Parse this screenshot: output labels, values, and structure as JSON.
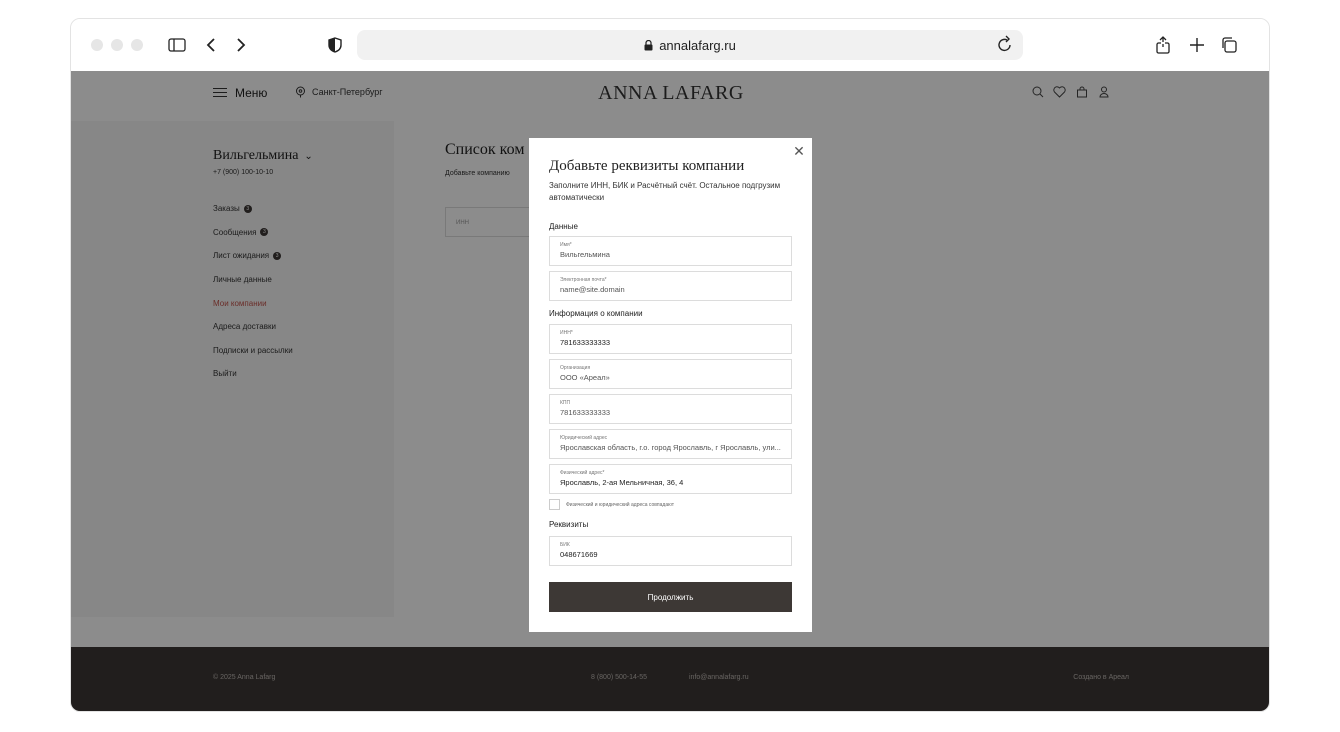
{
  "browser": {
    "url": "annalafarg.ru"
  },
  "header": {
    "menu_label": "Меню",
    "city": "Санкт-Петербург",
    "logo": "ANNA LAFARG"
  },
  "sidebar": {
    "user_name": "Вильгельмина",
    "phone": "+7 (900) 100-10-10",
    "items": [
      {
        "label": "Заказы",
        "badge": "3"
      },
      {
        "label": "Сообщения",
        "badge": "3"
      },
      {
        "label": "Лист ожидания",
        "badge": "3"
      },
      {
        "label": "Личные данные"
      },
      {
        "label": "Мои компании"
      },
      {
        "label": "Адреса доставки"
      },
      {
        "label": "Подписки и рассылки"
      },
      {
        "label": "Выйти"
      }
    ]
  },
  "content": {
    "title": "Список ком",
    "subtitle": "Добавьте компанию",
    "inn_placeholder": "ИНН"
  },
  "modal": {
    "title": "Добавьте реквизиты компании",
    "subtitle": "Заполните ИНН, БИК и Расчётный счёт. Остальное подгрузим автоматически",
    "section_data": "Данные",
    "name_label": "Имя*",
    "name_value": "Вильгельмина",
    "email_label": "Электронная почта*",
    "email_value": "name@site.domain",
    "section_company": "Информация о компании",
    "inn_label": "ИНН*",
    "inn_value": "781633333333",
    "org_label": "Организация",
    "org_value": "ООО «Ареал»",
    "kpp_label": "КПП",
    "kpp_value": "781633333333",
    "legal_label": "Юридический адрес",
    "legal_value": "Ярославская область, г.о. город Ярославль, г Ярославль, ули...",
    "phys_label": "Физический адрес*",
    "phys_value": "Ярославль, 2-ая Мельничная, 36, 4",
    "checkbox_label": "Физический и юридический адреса совпадают",
    "section_requisites": "Реквизиты",
    "bik_label": "БИК",
    "bik_value": "048671669",
    "submit": "Продолжить"
  },
  "footer": {
    "copyright": "© 2025 Anna Lafarg",
    "phone": "8 (800) 500-14-55",
    "email": "info@annalafarg.ru",
    "made_by": "Создано в Ареал"
  }
}
